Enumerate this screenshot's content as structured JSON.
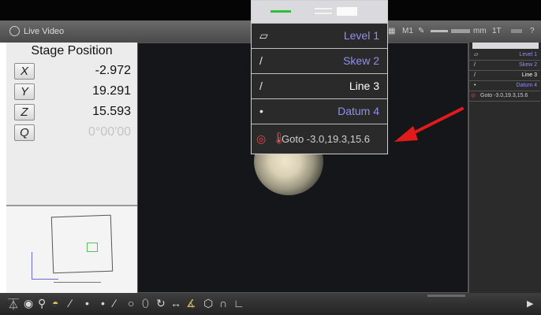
{
  "window": {
    "title": "Live Video",
    "toolbar_labels": {
      "m1": "M1",
      "units": "mm",
      "count": "1T"
    }
  },
  "stage": {
    "title": "Stage Position",
    "axes": [
      {
        "label": "X",
        "value": "-2.972"
      },
      {
        "label": "Y",
        "value": "19.291"
      },
      {
        "label": "Z",
        "value": "15.593"
      },
      {
        "label": "Q",
        "value": "0°00'00"
      }
    ]
  },
  "popup": {
    "features": [
      {
        "name": "Level 1",
        "icon": "parallelogram-icon",
        "color": "#8f8ff0"
      },
      {
        "name": "Skew 2",
        "icon": "line-icon",
        "color": "#8f8ff0"
      },
      {
        "name": "Line 3",
        "icon": "line-icon",
        "color": "#ffffff"
      },
      {
        "name": "Datum 4",
        "icon": "point-icon",
        "color": "#8f8ff0"
      }
    ],
    "goto": {
      "label": "Goto -3.0,19.3,15.6",
      "icon": "target-icon"
    }
  },
  "right_list": {
    "features": [
      {
        "name": "Level 1"
      },
      {
        "name": "Skew 2"
      },
      {
        "name": "Line 3"
      },
      {
        "name": "Datum 4"
      }
    ],
    "goto_label": "Goto -3.0,19.3,15.6"
  },
  "annotation": {
    "arrow_color": "#e11b1b"
  }
}
